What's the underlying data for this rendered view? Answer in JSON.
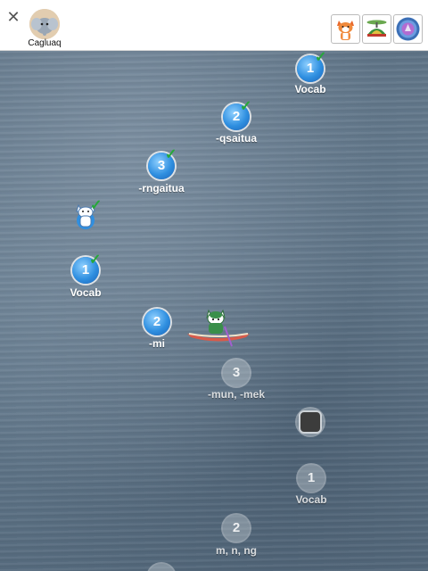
{
  "header": {
    "close_icon": "close-icon",
    "profile_name": "Cagluaq",
    "buttons": [
      {
        "name": "fox-character-button",
        "icon": "fox-icon"
      },
      {
        "name": "propeller-hat-button",
        "icon": "propeller-hat-icon"
      },
      {
        "name": "badge-button",
        "icon": "badge-icon"
      }
    ]
  },
  "path": {
    "nodes": [
      {
        "number": "1",
        "label": "Vocab",
        "status": "completed"
      },
      {
        "number": "2",
        "label": "-qsaitua",
        "status": "completed"
      },
      {
        "number": "3",
        "label": "-rngaitua",
        "status": "completed"
      },
      {
        "number": "",
        "label": "",
        "status": "completed",
        "icon": "husky-icon"
      },
      {
        "number": "1",
        "label": "Vocab",
        "status": "completed"
      },
      {
        "number": "2",
        "label": "-mi",
        "status": "current"
      },
      {
        "number": "3",
        "label": "-mun, -mek",
        "status": "locked"
      },
      {
        "number": "",
        "label": "",
        "status": "locked",
        "icon": "treasure-chest-icon"
      },
      {
        "number": "1",
        "label": "Vocab",
        "status": "locked"
      },
      {
        "number": "2",
        "label": "m, n, ng",
        "status": "locked"
      }
    ],
    "check_glyph": "✓"
  },
  "colors": {
    "completed": "#2f8fe0",
    "check": "#27a83a",
    "water": "#5f7487",
    "kayak": "#d85a4a"
  }
}
